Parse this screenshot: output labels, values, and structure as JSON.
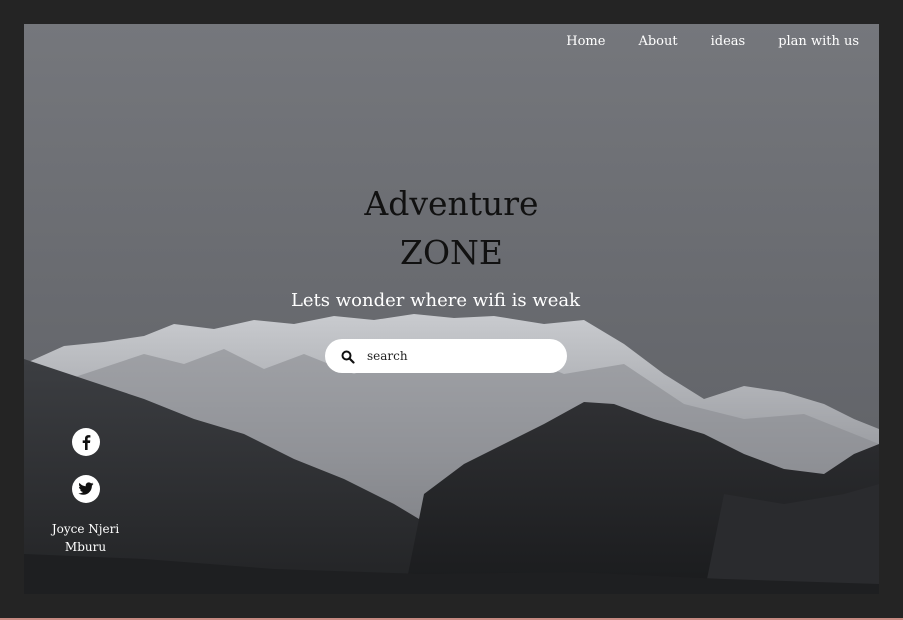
{
  "nav": {
    "items": [
      {
        "label": "Home"
      },
      {
        "label": "About"
      },
      {
        "label": "ideas"
      },
      {
        "label": "plan with us"
      }
    ]
  },
  "hero": {
    "title_line1": "Adventure",
    "title_line2": "ZONE",
    "subtitle": "Lets wonder where wifi is weak"
  },
  "search": {
    "placeholder": "search",
    "icon": "search-icon"
  },
  "social": {
    "icons": [
      "facebook-icon",
      "twitter-icon"
    ],
    "author_line1": "Joyce Njeri",
    "author_line2": "Mburu"
  },
  "colors": {
    "page_background": "#242424",
    "text_light": "#ffffff",
    "title_dark": "#111111",
    "bottom_accent": "#c98a83"
  }
}
